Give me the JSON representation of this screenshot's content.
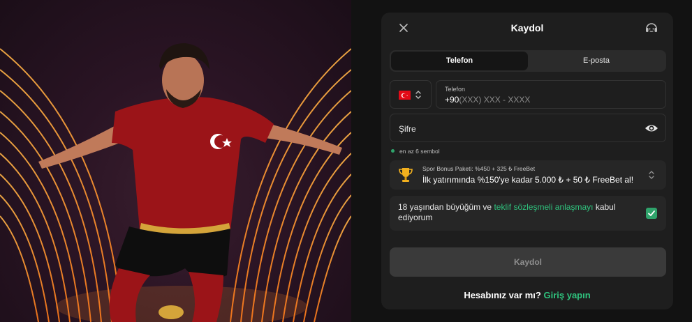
{
  "modal": {
    "title": "Kaydol",
    "tabs": [
      "Telefon",
      "E-posta"
    ],
    "country": {
      "code": "TR"
    },
    "phone": {
      "label": "Telefon",
      "prefix": "+90",
      "placeholder": "(XXX) XXX - XXXX"
    },
    "password": {
      "placeholder": "Şifre",
      "hint": "en az 6 sembol"
    },
    "bonus": {
      "subtitle": "Spor Bonus Paketi: %450 + 325 ₺ FreeBet",
      "text": "İlk yatırımında %150'ye kadar 5.000 ₺ + 50 ₺ FreeBet al!"
    },
    "terms": {
      "before": "18 yaşından büyüğüm ve ",
      "link": "teklif sözleşmeli anlaşmayı",
      "after": " kabul ediyorum",
      "checked": true
    },
    "submit_label": "Kaydol",
    "login_prompt": "Hesabınız var mı?",
    "login_link": "Giriş yapın"
  },
  "colors": {
    "accent": "#2fc47e",
    "checkbox": "#2fa36b",
    "modal_bg": "#1e1e1e",
    "page_bg": "#121212",
    "flag_red": "#e30a17"
  },
  "icons": [
    "close-icon",
    "headset-icon",
    "flag-tr-icon",
    "up-down-chevron-icon",
    "eye-icon",
    "trophy-icon"
  ]
}
